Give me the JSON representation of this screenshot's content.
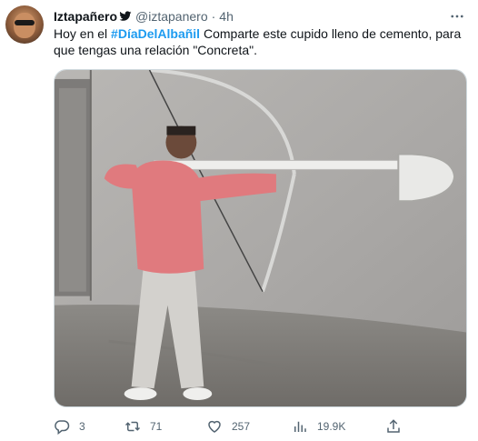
{
  "user": {
    "display_name": "Iztapañero",
    "handle": "@iztapanero",
    "separator": "·",
    "time": "4h"
  },
  "tweet": {
    "text_before": "Hoy en el ",
    "hashtag": "#DíaDelAlbañil",
    "text_after": " Comparte este cupido lleno de cemento, para que tengas una relación \"Concreta\"."
  },
  "media": {
    "icon": "photo-meme-icon"
  },
  "actions": {
    "reply_count": "3",
    "retweet_count": "71",
    "like_count": "257",
    "views_count": "19.9K"
  },
  "colors": {
    "accent": "#1d9bf0",
    "secondary_text": "#536471",
    "border": "#cfd9de"
  }
}
